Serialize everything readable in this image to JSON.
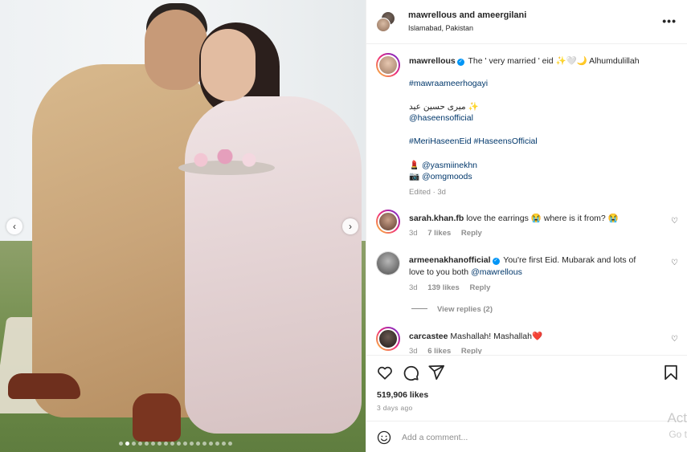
{
  "post": {
    "header": {
      "title": "mawrellous and ameergilani",
      "location": "Islamabad, Pakistan",
      "more_icon": "more-horizontal-icon"
    },
    "carousel": {
      "prev_icon": "chevron-left-icon",
      "next_icon": "chevron-right-icon",
      "slide_count": 18,
      "active_index": 1
    },
    "caption": {
      "username": "mawrellous",
      "line1": "The ' very married ' eid ✨🤍🌙 Alhumdulillah",
      "hashtag1": "#mawraameerhogayi",
      "urdu": "میری حسین عید ✨",
      "tag1": "@haseensofficial",
      "hashtags2": "#MeriHaseenEid #HaseensOfficial",
      "credit1_emoji": "💄",
      "credit1": "@yasmiinekhn",
      "credit2_emoji": "📷",
      "credit2": "@omgmoods",
      "edited": "Edited · 3d"
    },
    "comments": [
      {
        "username": "sarah.khan.fb",
        "text": "love the earrings 😭 where is it from? 😭",
        "time": "3d",
        "likes": "7 likes",
        "reply": "Reply"
      },
      {
        "username": "armeenakhanofficial",
        "text1": "You're first Eid. Mubarak and lots of",
        "text2": "love to you both",
        "mention": "@mawrellous",
        "time": "3d",
        "likes": "139 likes",
        "reply": "Reply"
      },
      {
        "username": "carcastee",
        "text": "Mashallah! Mashallah❤️",
        "time": "3d",
        "likes": "6 likes",
        "reply": "Reply"
      }
    ],
    "view_replies": "View replies (2)",
    "actions": {
      "like_icon": "heart-icon",
      "comment_icon": "comment-icon",
      "share_icon": "send-icon",
      "save_icon": "bookmark-icon"
    },
    "likes": "519,906 likes",
    "time_ago": "3 days ago",
    "add_comment": {
      "placeholder": "Add a comment..."
    }
  },
  "watermark": {
    "line1": "Act",
    "line2": "Go t"
  }
}
